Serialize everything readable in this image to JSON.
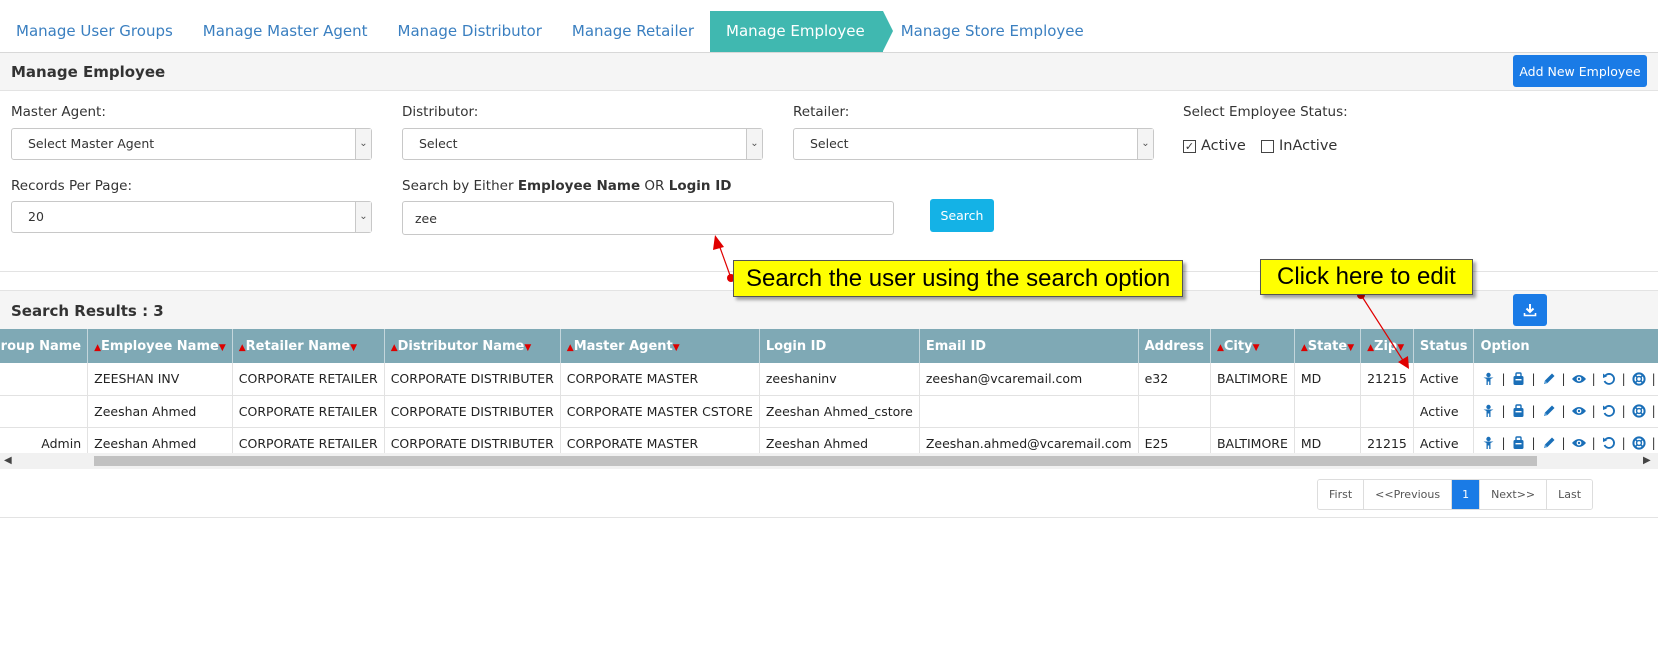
{
  "tabs": [
    {
      "label": "Manage User Groups"
    },
    {
      "label": "Manage Master Agent"
    },
    {
      "label": "Manage Distributor"
    },
    {
      "label": "Manage Retailer"
    },
    {
      "label": "Manage Employee",
      "active": true
    },
    {
      "label": "Manage Store Employee"
    }
  ],
  "header": {
    "title": "Manage Employee",
    "add_button": "Add New Employee"
  },
  "filters": {
    "master_agent_label": "Master Agent:",
    "master_agent_value": "Select Master Agent",
    "distributor_label": "Distributor:",
    "distributor_value": "Select",
    "retailer_label": "Retailer:",
    "retailer_value": "Select",
    "status_label": "Select Employee Status:",
    "status_active": "Active",
    "status_active_checked": true,
    "status_inactive": "InActive",
    "status_inactive_checked": false,
    "records_label": "Records Per Page:",
    "records_value": "20",
    "search_label_prefix": "Search by Either ",
    "search_label_name": "Employee Name",
    "search_label_or": " OR ",
    "search_label_login": "Login ID",
    "search_value": "zee",
    "search_button": "Search"
  },
  "results": {
    "title": "Search Results : 3",
    "columns": [
      "Group Name",
      "Employee Name",
      "Retailer Name",
      "Distributor Name",
      "Master Agent",
      "Login ID",
      "Email ID",
      "Address",
      "City",
      "State",
      "Zip",
      "Status",
      "Option"
    ],
    "rows": [
      [
        "",
        "ZEESHAN INV",
        "CORPORATE RETAILER",
        "CORPORATE DISTRIBUTER",
        "CORPORATE MASTER",
        "zeeshaninv",
        "zeeshan@vcaremail.com",
        "e32",
        "BALTIMORE",
        "MD",
        "21215",
        "Active"
      ],
      [
        "",
        "Zeeshan Ahmed",
        "CORPORATE RETAILER",
        "CORPORATE DISTRIBUTER",
        "CORPORATE MASTER CSTORE",
        "Zeeshan Ahmed_cstore",
        "",
        "",
        "",
        "",
        "",
        "Active"
      ],
      [
        "Admin",
        "Zeeshan Ahmed",
        "CORPORATE RETAILER",
        "CORPORATE DISTRIBUTER",
        "CORPORATE MASTER",
        "Zeeshan Ahmed",
        "Zeeshan.ahmed@vcaremail.com",
        "E25",
        "BALTIMORE",
        "MD",
        "21215",
        "Active"
      ]
    ],
    "option_icons": [
      "user-icon",
      "bag-icon",
      "edit-icon",
      "view-icon",
      "reset-icon",
      "support-icon",
      "link-icon"
    ]
  },
  "pagination": {
    "first": "First",
    "previous": "<<Previous",
    "current": "1",
    "next": "Next>>",
    "last": "Last"
  },
  "annotations": {
    "search_callout": "Search the user using the search option",
    "edit_callout": "Click here to edit"
  },
  "colors": {
    "tab_active": "#40b8b0",
    "primary": "#1a7be6",
    "search": "#14b2e6",
    "table_header": "#7fa9b5",
    "callout": "#ffff00",
    "arrow": "#e00000"
  }
}
